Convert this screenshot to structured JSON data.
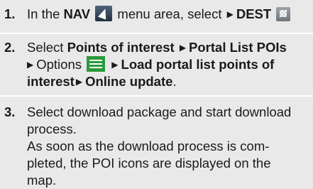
{
  "steps": [
    {
      "number": "1.",
      "in_the": "In the",
      "nav": "NAV",
      "menu_area_select": "menu area, select",
      "dest": "DEST"
    },
    {
      "number": "2.",
      "select": "Select",
      "points_of_interest": "Points of interest",
      "portal_list_pois": "Portal List POIs",
      "options": "Options",
      "load_portal_list_1": "Load portal list points of",
      "load_portal_list_2": "interest",
      "online_update": "Online update",
      "period": "."
    },
    {
      "number": "3.",
      "line1": "Select download package and start download",
      "line2": "process.",
      "line3": "As soon as the download process is com-",
      "line4": "pleted, the POI icons are displayed on the",
      "line5": "map."
    }
  ],
  "icons": {
    "nav_icon": "navigation-arrow-icon",
    "dest_icon": "checkered-flag-icon",
    "options_icon": "list-menu-icon",
    "arrow": "right-triangle-icon"
  },
  "colors": {
    "step_background": "#e9e9e9",
    "options_icon_green": "#2a9a3b"
  }
}
